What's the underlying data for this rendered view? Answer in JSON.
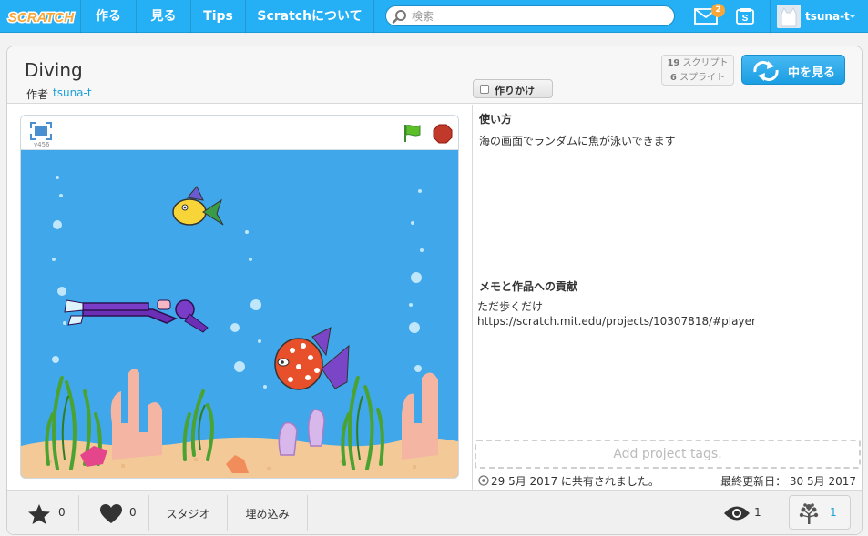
{
  "nav": {
    "logo_text": "SCRATCH",
    "items": [
      "作る",
      "見る",
      "Tips",
      "Scratchについて"
    ],
    "search_placeholder": "検索",
    "messages_count": "2",
    "username": "tsuna-t"
  },
  "project": {
    "title": "Diving",
    "author_label": "作者",
    "author": "tsuna-t",
    "wip_label": "作りかけ",
    "scripts_count": "19",
    "scripts_label": "スクリプト",
    "sprites_count": "6",
    "sprites_label": "スプライト",
    "see_inside_label": "中を見る"
  },
  "player": {
    "version": "v456"
  },
  "info": {
    "instructions_heading": "使い方",
    "instructions_text": "海の画面でランダムに魚が泳いできます",
    "notes_heading": "メモと作品への貢献",
    "notes_line1": "ただ歩くだけ",
    "notes_line2": "https://scratch.mit.edu/projects/10307818/#player",
    "tags_placeholder": "Add project tags.",
    "shared_text": "29 5月 2017 に共有されました。",
    "updated_text": "最終更新日： 30 5月 2017"
  },
  "footer": {
    "favorites_count": "0",
    "loves_count": "0",
    "studio_label": "スタジオ",
    "embed_label": "埋め込み",
    "views_count": "1",
    "remix_count": "1"
  },
  "colors": {
    "nav_blue": "#25aff4",
    "link_blue": "#1aa0d8",
    "ocean": "#3fa7ea",
    "sand": "#f3c997",
    "badge_orange": "#f9a739"
  }
}
